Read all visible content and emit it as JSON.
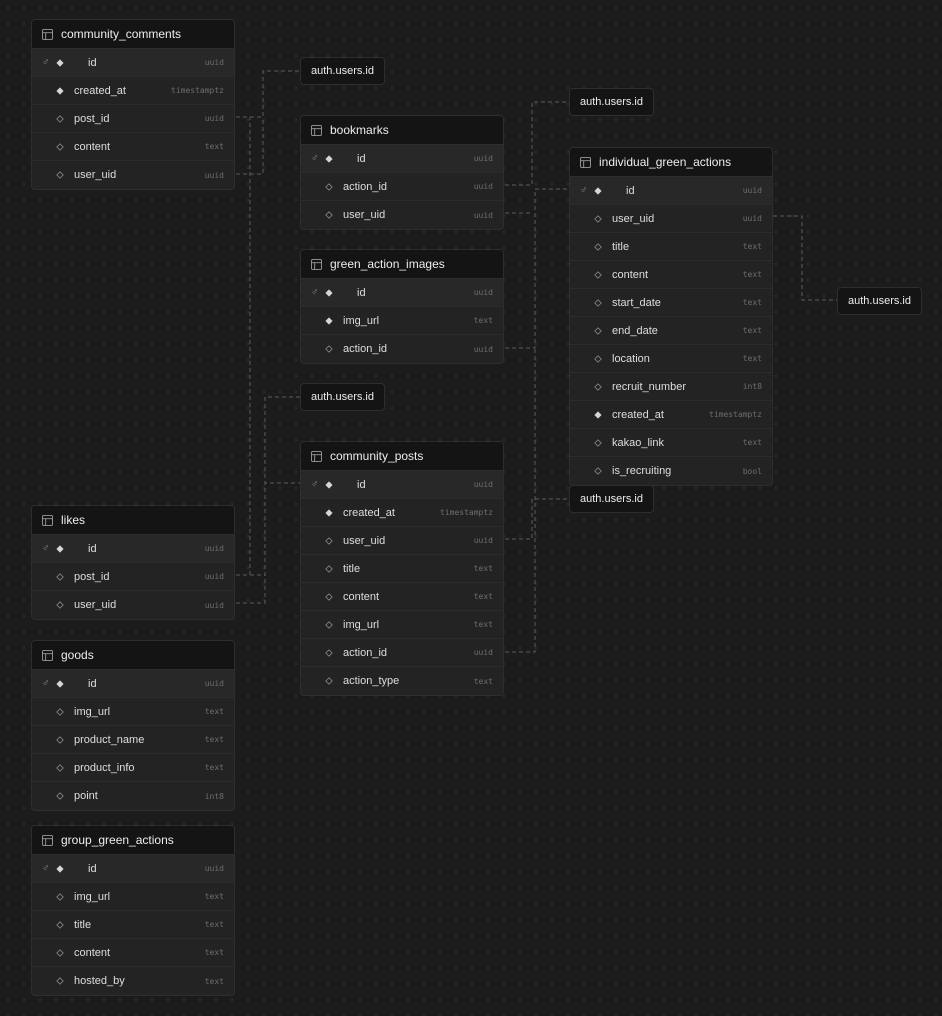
{
  "tables": [
    {
      "id": "community_comments",
      "name": "community_comments",
      "columns": [
        {
          "name": "id",
          "type": "uuid",
          "pk": true,
          "nullable": false
        },
        {
          "name": "created_at",
          "type": "timestamptz",
          "pk": false,
          "nullable": false
        },
        {
          "name": "post_id",
          "type": "uuid",
          "pk": false,
          "nullable": true
        },
        {
          "name": "content",
          "type": "text",
          "pk": false,
          "nullable": true
        },
        {
          "name": "user_uid",
          "type": "uuid",
          "pk": false,
          "nullable": true
        }
      ]
    },
    {
      "id": "bookmarks",
      "name": "bookmarks",
      "columns": [
        {
          "name": "id",
          "type": "uuid",
          "pk": true,
          "nullable": false
        },
        {
          "name": "action_id",
          "type": "uuid",
          "pk": false,
          "nullable": true
        },
        {
          "name": "user_uid",
          "type": "uuid",
          "pk": false,
          "nullable": true
        }
      ]
    },
    {
      "id": "green_action_images",
      "name": "green_action_images",
      "columns": [
        {
          "name": "id",
          "type": "uuid",
          "pk": true,
          "nullable": false
        },
        {
          "name": "img_url",
          "type": "text",
          "pk": false,
          "nullable": false
        },
        {
          "name": "action_id",
          "type": "uuid",
          "pk": false,
          "nullable": true
        }
      ]
    },
    {
      "id": "individual_green_actions",
      "name": "individual_green_actions",
      "columns": [
        {
          "name": "id",
          "type": "uuid",
          "pk": true,
          "nullable": false
        },
        {
          "name": "user_uid",
          "type": "uuid",
          "pk": false,
          "nullable": true
        },
        {
          "name": "title",
          "type": "text",
          "pk": false,
          "nullable": true
        },
        {
          "name": "content",
          "type": "text",
          "pk": false,
          "nullable": true
        },
        {
          "name": "start_date",
          "type": "text",
          "pk": false,
          "nullable": true
        },
        {
          "name": "end_date",
          "type": "text",
          "pk": false,
          "nullable": true
        },
        {
          "name": "location",
          "type": "text",
          "pk": false,
          "nullable": true
        },
        {
          "name": "recruit_number",
          "type": "int8",
          "pk": false,
          "nullable": true
        },
        {
          "name": "created_at",
          "type": "timestamptz",
          "pk": false,
          "nullable": false
        },
        {
          "name": "kakao_link",
          "type": "text",
          "pk": false,
          "nullable": true
        },
        {
          "name": "is_recruiting",
          "type": "bool",
          "pk": false,
          "nullable": true
        }
      ]
    },
    {
      "id": "community_posts",
      "name": "community_posts",
      "columns": [
        {
          "name": "id",
          "type": "uuid",
          "pk": true,
          "nullable": false
        },
        {
          "name": "created_at",
          "type": "timestamptz",
          "pk": false,
          "nullable": false
        },
        {
          "name": "user_uid",
          "type": "uuid",
          "pk": false,
          "nullable": true
        },
        {
          "name": "title",
          "type": "text",
          "pk": false,
          "nullable": true
        },
        {
          "name": "content",
          "type": "text",
          "pk": false,
          "nullable": true
        },
        {
          "name": "img_url",
          "type": "text",
          "pk": false,
          "nullable": true
        },
        {
          "name": "action_id",
          "type": "uuid",
          "pk": false,
          "nullable": true
        },
        {
          "name": "action_type",
          "type": "text",
          "pk": false,
          "nullable": true
        }
      ]
    },
    {
      "id": "likes",
      "name": "likes",
      "columns": [
        {
          "name": "id",
          "type": "uuid",
          "pk": true,
          "nullable": false
        },
        {
          "name": "post_id",
          "type": "uuid",
          "pk": false,
          "nullable": true
        },
        {
          "name": "user_uid",
          "type": "uuid",
          "pk": false,
          "nullable": true
        }
      ]
    },
    {
      "id": "goods",
      "name": "goods",
      "columns": [
        {
          "name": "id",
          "type": "uuid",
          "pk": true,
          "nullable": false
        },
        {
          "name": "img_url",
          "type": "text",
          "pk": false,
          "nullable": true
        },
        {
          "name": "product_name",
          "type": "text",
          "pk": false,
          "nullable": true
        },
        {
          "name": "product_info",
          "type": "text",
          "pk": false,
          "nullable": true
        },
        {
          "name": "point",
          "type": "int8",
          "pk": false,
          "nullable": true
        }
      ]
    },
    {
      "id": "group_green_actions",
      "name": "group_green_actions",
      "columns": [
        {
          "name": "id",
          "type": "uuid",
          "pk": true,
          "nullable": false
        },
        {
          "name": "img_url",
          "type": "text",
          "pk": false,
          "nullable": true
        },
        {
          "name": "title",
          "type": "text",
          "pk": false,
          "nullable": true
        },
        {
          "name": "content",
          "type": "text",
          "pk": false,
          "nullable": true
        },
        {
          "name": "hosted_by",
          "type": "text",
          "pk": false,
          "nullable": true
        }
      ]
    }
  ],
  "refs": [
    {
      "id": "ref1",
      "label": "auth.users.id"
    },
    {
      "id": "ref2",
      "label": "auth.users.id"
    },
    {
      "id": "ref3",
      "label": "auth.users.id"
    },
    {
      "id": "ref4",
      "label": "auth.users.id"
    },
    {
      "id": "ref5",
      "label": "auth.users.id"
    }
  ],
  "colors": {
    "background": "#1c1c1c",
    "table_header": "#141414",
    "table_body": "#232323",
    "edge": "#5c5c5c"
  },
  "icons": {
    "table": "table-grid-icon",
    "primary_key": "key-icon",
    "not_null": "filled-diamond-icon",
    "nullable": "hollow-diamond-icon"
  }
}
